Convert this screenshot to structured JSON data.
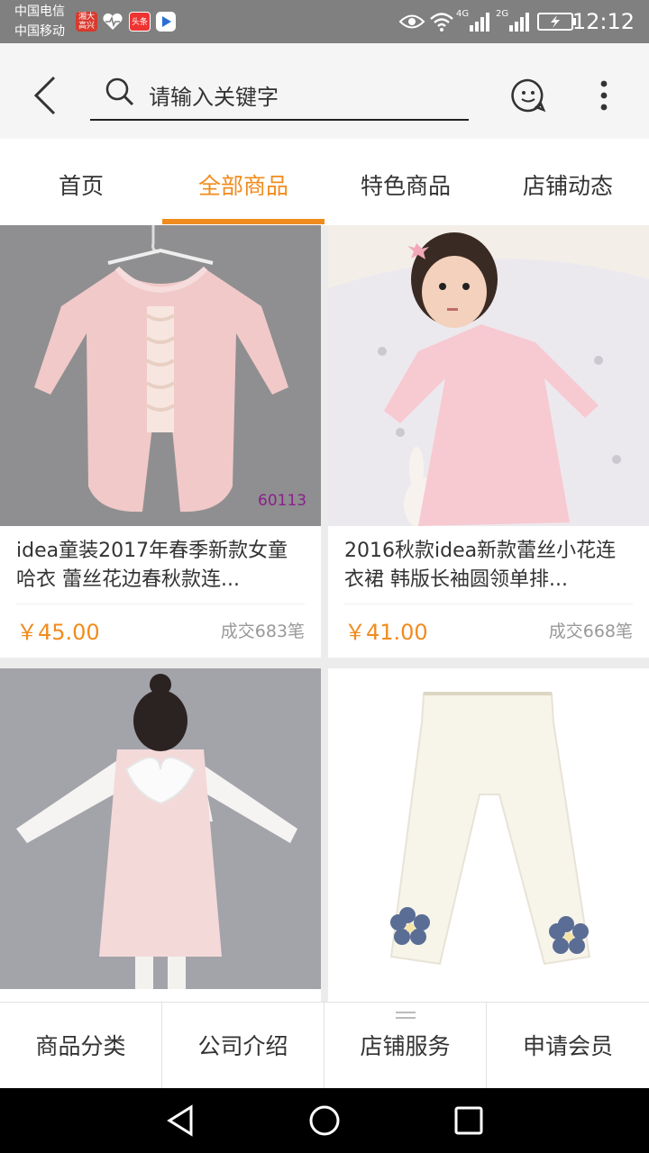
{
  "status_bar": {
    "carrier_1": "中国电信",
    "carrier_2": "中国移动",
    "network_1": "4G",
    "network_2": "2G",
    "time": "12:12",
    "app_badges": [
      "湘大 高兴",
      "头条"
    ]
  },
  "search": {
    "placeholder": "请输入关键字"
  },
  "tabs": [
    {
      "label": "首页",
      "active": false
    },
    {
      "label": "全部商品",
      "active": true
    },
    {
      "label": "特色商品",
      "active": false
    },
    {
      "label": "店铺动态",
      "active": false
    }
  ],
  "products": [
    {
      "title": "idea童装2017年春季新款女童哈衣 蕾丝花边春秋款连...",
      "price": "￥45.00",
      "sold": "成交683笔",
      "image_code": "60113"
    },
    {
      "title": "2016秋款idea新款蕾丝小花连衣裙 韩版长袖圆领单排...",
      "price": "￥41.00",
      "sold": "成交668笔"
    },
    {
      "title": "",
      "price": "",
      "sold": ""
    },
    {
      "title": "",
      "price": "",
      "sold": ""
    }
  ],
  "bottom_menu": [
    {
      "label": "商品分类"
    },
    {
      "label": "公司介绍"
    },
    {
      "label": "店铺服务"
    },
    {
      "label": "申请会员"
    }
  ],
  "colors": {
    "accent": "#f08c1e",
    "status_bar": "#808080",
    "header_bg": "#f5f5f5"
  }
}
